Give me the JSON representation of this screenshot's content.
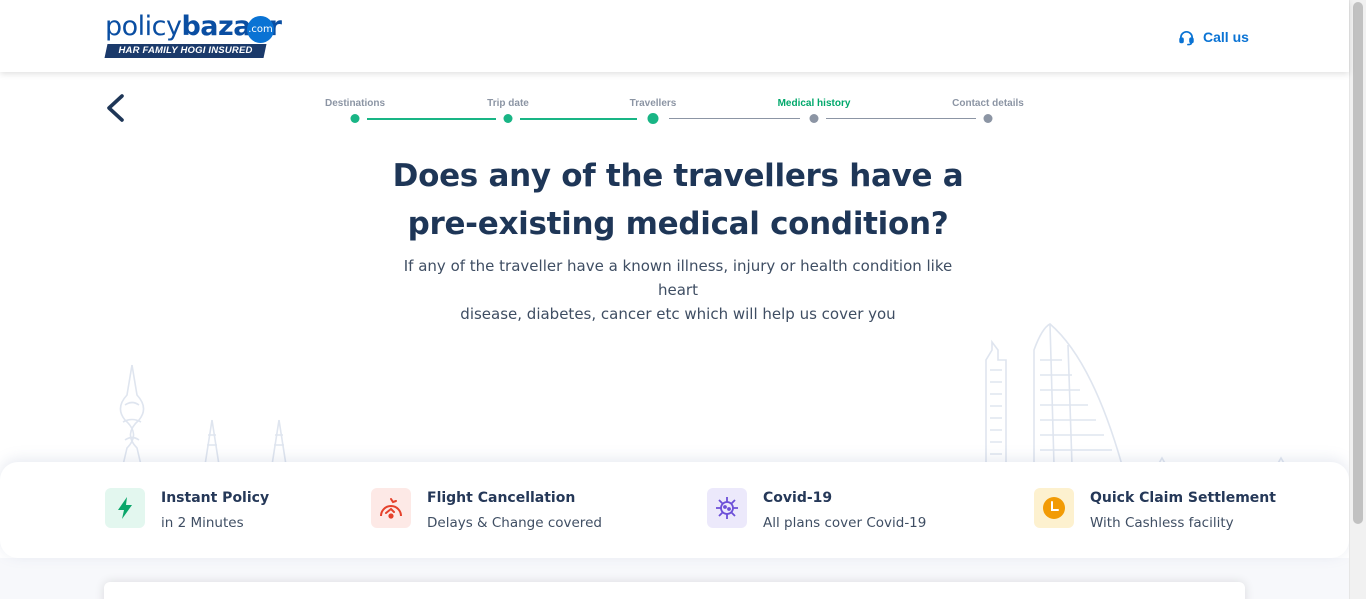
{
  "header": {
    "logo": {
      "brand_1": "policy",
      "brand_2": "bazaar",
      "com": ".com",
      "tagline": "HAR FAMILY HOGI INSURED"
    },
    "call_label": "Call us",
    "call_icon": "headset-icon"
  },
  "stepper": {
    "steps": [
      {
        "label": "Destinations",
        "state": "done"
      },
      {
        "label": "Trip date",
        "state": "done"
      },
      {
        "label": "Travellers",
        "state": "current"
      },
      {
        "label": "Medical history",
        "state": "active"
      },
      {
        "label": "Contact details",
        "state": "pending"
      }
    ]
  },
  "question": {
    "line1": "Does any of the travellers have a",
    "line2": "pre-existing medical condition?",
    "sub1": "If any of the traveller have a known illness, injury or health condition like heart",
    "sub2": "disease, diabetes, cancer etc which will help us cover you"
  },
  "features": [
    {
      "title": "Instant Policy",
      "subtitle": "in 2 Minutes",
      "icon": "lightning-icon",
      "bg": "#e3f7ef",
      "color": "#0aa66a"
    },
    {
      "title": "Flight Cancellation",
      "subtitle": "Delays & Change covered",
      "icon": "flight-cancel-icon",
      "bg": "#fde9e6",
      "color": "#e5412b"
    },
    {
      "title": "Covid-19",
      "subtitle": "All plans cover Covid-19",
      "icon": "virus-icon",
      "bg": "#ece9fb",
      "color": "#6c4fd8"
    },
    {
      "title": "Quick Claim Settlement",
      "subtitle": "With Cashless facility",
      "icon": "clock-icon",
      "bg": "#fdf1cf",
      "color": "#f29b05"
    }
  ],
  "colors": {
    "primary": "#0a73d4",
    "accent_green": "#19b585",
    "heading": "#1e3657"
  }
}
